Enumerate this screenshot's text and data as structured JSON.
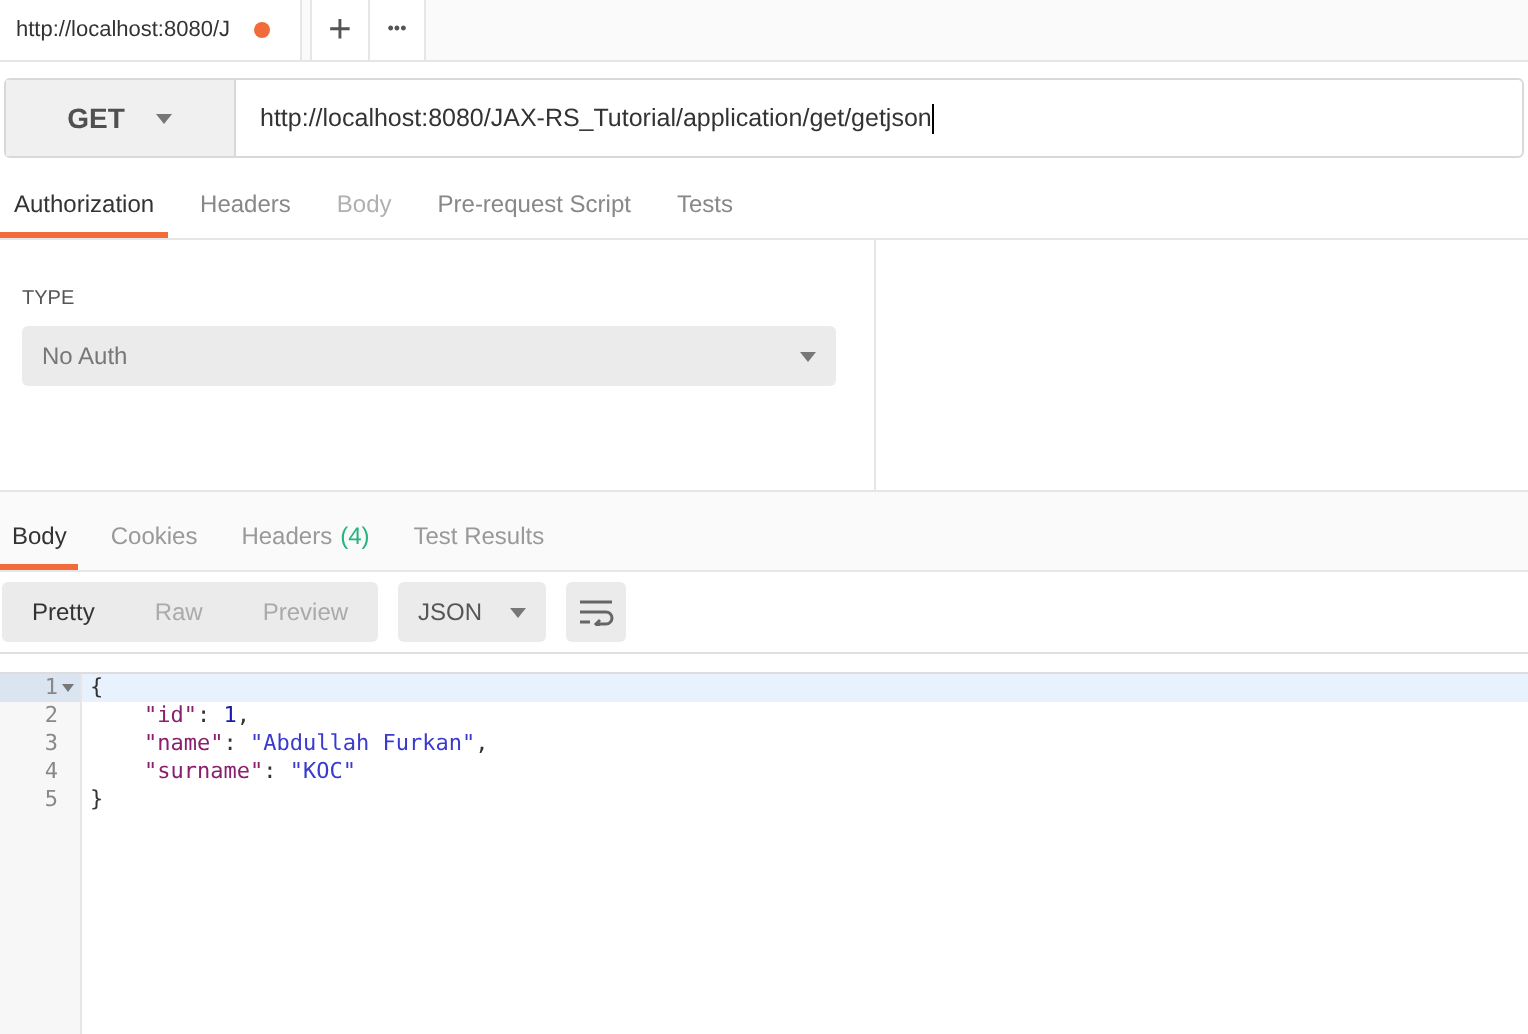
{
  "request_tabs": [
    {
      "label": "http://localhost:8080/J",
      "unsaved": true,
      "selected": true
    }
  ],
  "tab_actions": {
    "new": "+",
    "more": "•••"
  },
  "request": {
    "method": "GET",
    "url": "http://localhost:8080/JAX-RS_Tutorial/application/get/getjson"
  },
  "request_sections": [
    {
      "label": "Authorization",
      "selected": true,
      "disabled": false
    },
    {
      "label": "Headers",
      "selected": false,
      "disabled": false
    },
    {
      "label": "Body",
      "selected": false,
      "disabled": true
    },
    {
      "label": "Pre-request Script",
      "selected": false,
      "disabled": false
    },
    {
      "label": "Tests",
      "selected": false,
      "disabled": false
    }
  ],
  "auth": {
    "type_label": "TYPE",
    "type": "No Auth"
  },
  "response_tabs": [
    {
      "label": "Body",
      "selected": true
    },
    {
      "label": "Cookies",
      "selected": false
    },
    {
      "label": "Headers",
      "count": "(4)",
      "selected": false
    },
    {
      "label": "Test Results",
      "selected": false
    }
  ],
  "view_modes": [
    {
      "label": "Pretty",
      "selected": true
    },
    {
      "label": "Raw",
      "selected": false
    },
    {
      "label": "Preview",
      "selected": false
    }
  ],
  "format": "JSON",
  "code_lines": [
    {
      "number": "1",
      "foldable": true,
      "current": true,
      "indented": false,
      "tokens": [
        {
          "kind": "punct",
          "text": "{"
        }
      ]
    },
    {
      "number": "2",
      "foldable": false,
      "current": false,
      "indented": true,
      "tokens": [
        {
          "kind": "key",
          "text": "\"id\""
        },
        {
          "kind": "punct",
          "text": ": "
        },
        {
          "kind": "number",
          "text": "1"
        },
        {
          "kind": "punct",
          "text": ","
        }
      ]
    },
    {
      "number": "3",
      "foldable": false,
      "current": false,
      "indented": true,
      "tokens": [
        {
          "kind": "key",
          "text": "\"name\""
        },
        {
          "kind": "punct",
          "text": ": "
        },
        {
          "kind": "string",
          "text": "\"Abdullah Furkan\""
        },
        {
          "kind": "punct",
          "text": ","
        }
      ]
    },
    {
      "number": "4",
      "foldable": false,
      "current": false,
      "indented": true,
      "tokens": [
        {
          "kind": "key",
          "text": "\"surname\""
        },
        {
          "kind": "punct",
          "text": ": "
        },
        {
          "kind": "string",
          "text": "\"KOC\""
        }
      ]
    },
    {
      "number": "5",
      "foldable": false,
      "current": false,
      "indented": false,
      "tokens": [
        {
          "kind": "punct",
          "text": "}"
        }
      ]
    }
  ]
}
